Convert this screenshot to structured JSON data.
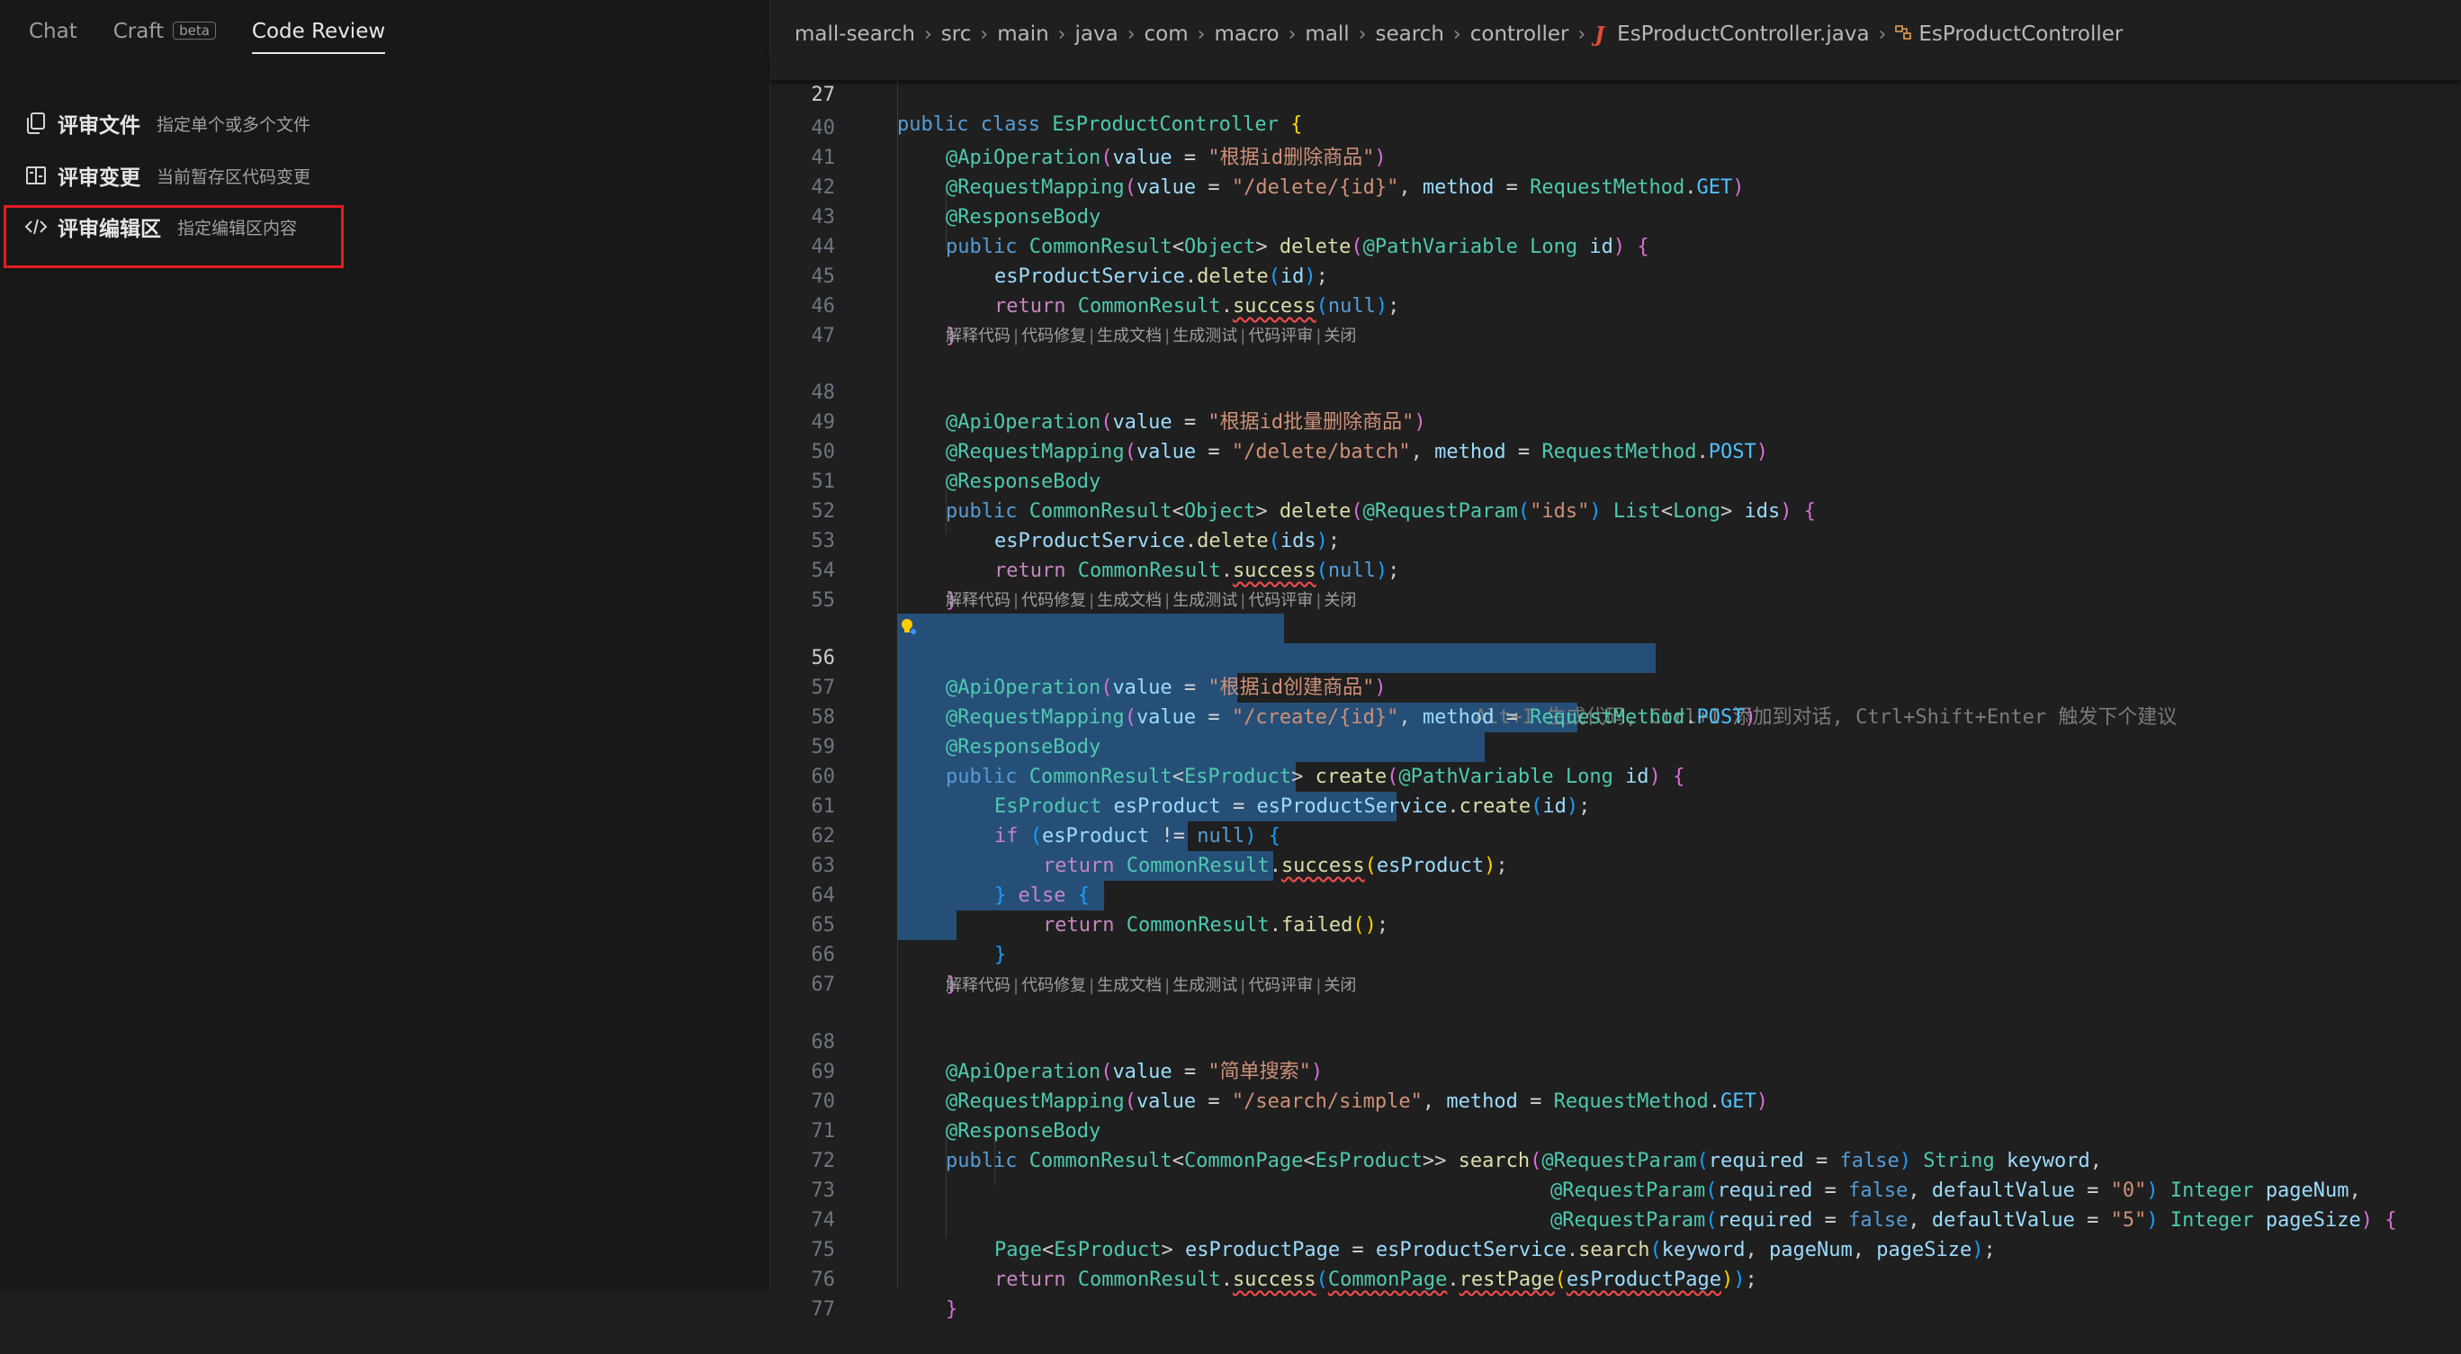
{
  "left_panel": {
    "tabs": [
      {
        "label": "Chat",
        "active": false
      },
      {
        "label": "Craft",
        "badge": "beta",
        "active": false
      },
      {
        "label": "Code Review",
        "active": true
      }
    ],
    "menu_items": [
      {
        "label": "评审文件",
        "description": "指定单个或多个文件",
        "icon": "files-icon"
      },
      {
        "label": "评审变更",
        "description": "当前暂存区代码变更",
        "icon": "diff-icon"
      },
      {
        "label": "评审编辑区",
        "description": "指定编辑区内容",
        "icon": "code-icon",
        "highlighted": true
      }
    ],
    "highlight_color": "#e51c23"
  },
  "editor": {
    "breadcrumb": [
      "mall-search",
      "src",
      "main",
      "java",
      "com",
      "macro",
      "mall",
      "search",
      "controller",
      "EsProductController.java",
      "EsProductController"
    ],
    "sticky_line": {
      "number": "27",
      "text": "public class EsProductController {"
    },
    "codelens_items": [
      "解释代码",
      "代码修复",
      "生成文档",
      "生成测试",
      "代码评审",
      "关闭"
    ],
    "ghost_hint": "Alt+I 生成代码, Ctrl+I 添加到对话, Ctrl+Shift+Enter 触发下个建议",
    "line_numbers": {
      "l40": "40",
      "l41": "41",
      "l42": "42",
      "l43": "43",
      "l44": "44",
      "l45": "45",
      "l46": "46",
      "l47": "47",
      "l48": "48",
      "l49": "49",
      "l50": "50",
      "l51": "51",
      "l52": "52",
      "l53": "53",
      "l54": "54",
      "l55": "55",
      "l56": "56",
      "l57": "57",
      "l58": "58",
      "l59": "59",
      "l60": "60",
      "l61": "61",
      "l62": "62",
      "l63": "63",
      "l64": "64",
      "l65": "65",
      "l66": "66",
      "l67": "67",
      "l68": "68",
      "l69": "69",
      "l70": "70",
      "l71": "71",
      "l72": "72",
      "l73": "73",
      "l74": "74",
      "l75": "75",
      "l76": "76",
      "l77": "77"
    },
    "strings": {
      "s40": "\"根据id删除商品\"",
      "s41": "\"/delete/{id}\"",
      "s49a": "\"根据id批量删除商品\"",
      "s49b": "\"/delete/batch\"",
      "s51": "\"ids\"",
      "s56": "\"根据id创建商品\"",
      "s57": "\"/create/{id}\"",
      "s68": "\"简单搜索\"",
      "s69": "\"/search/simple\"",
      "s72": "\"0\"",
      "s73": "\"5\""
    },
    "colors": {
      "selection": "#264f78",
      "keyword": "#569cd6",
      "type": "#4ec9b0",
      "function": "#dcdcaa",
      "string": "#ce9178",
      "variable": "#9cdcfe"
    }
  }
}
